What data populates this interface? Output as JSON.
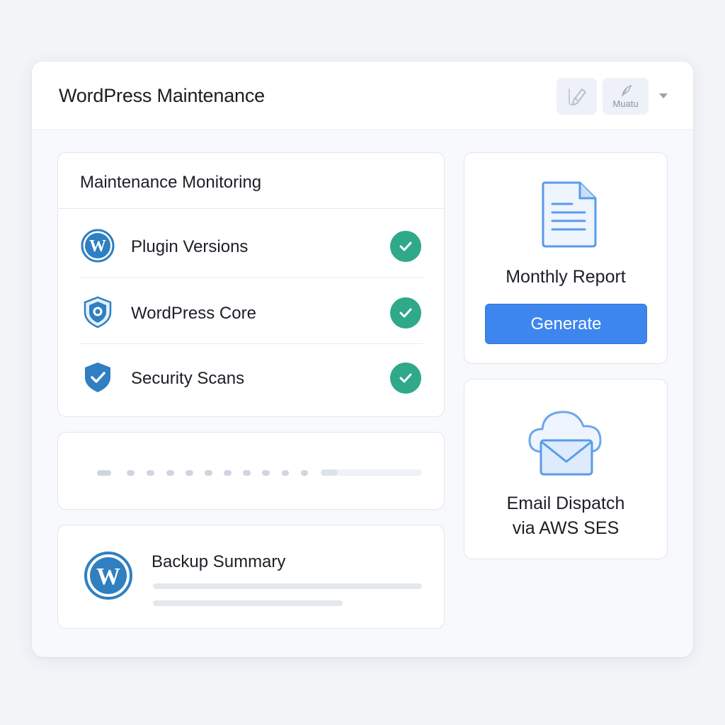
{
  "header": {
    "title": "WordPress Maintenance",
    "button1_icon": "pen-icon",
    "button2_icon": "quill-icon",
    "button2_label": "Muatu",
    "dropdown_icon": "chevron-down-icon"
  },
  "monitoring": {
    "title": "Maintenance Monitoring",
    "items": [
      {
        "label": "Plugin Versions",
        "icon": "wordpress-icon",
        "status": "ok"
      },
      {
        "label": "WordPress Core",
        "icon": "shield-badge-icon",
        "status": "ok"
      },
      {
        "label": "Security Scans",
        "icon": "shield-check-icon",
        "status": "ok"
      }
    ]
  },
  "progress": {
    "fill_fraction": 0.17
  },
  "backup": {
    "title": "Backup Summary",
    "icon": "wordpress-icon"
  },
  "report": {
    "title": "Monthly Report",
    "button_label": "Generate",
    "icon": "document-icon"
  },
  "email": {
    "line1": "Email Dispatch",
    "line2": "via AWS SES",
    "icon": "cloud-mail-icon"
  },
  "colors": {
    "accent": "#3d86ee",
    "success": "#2fa98a",
    "wp_blue": "#2f7fc1"
  }
}
